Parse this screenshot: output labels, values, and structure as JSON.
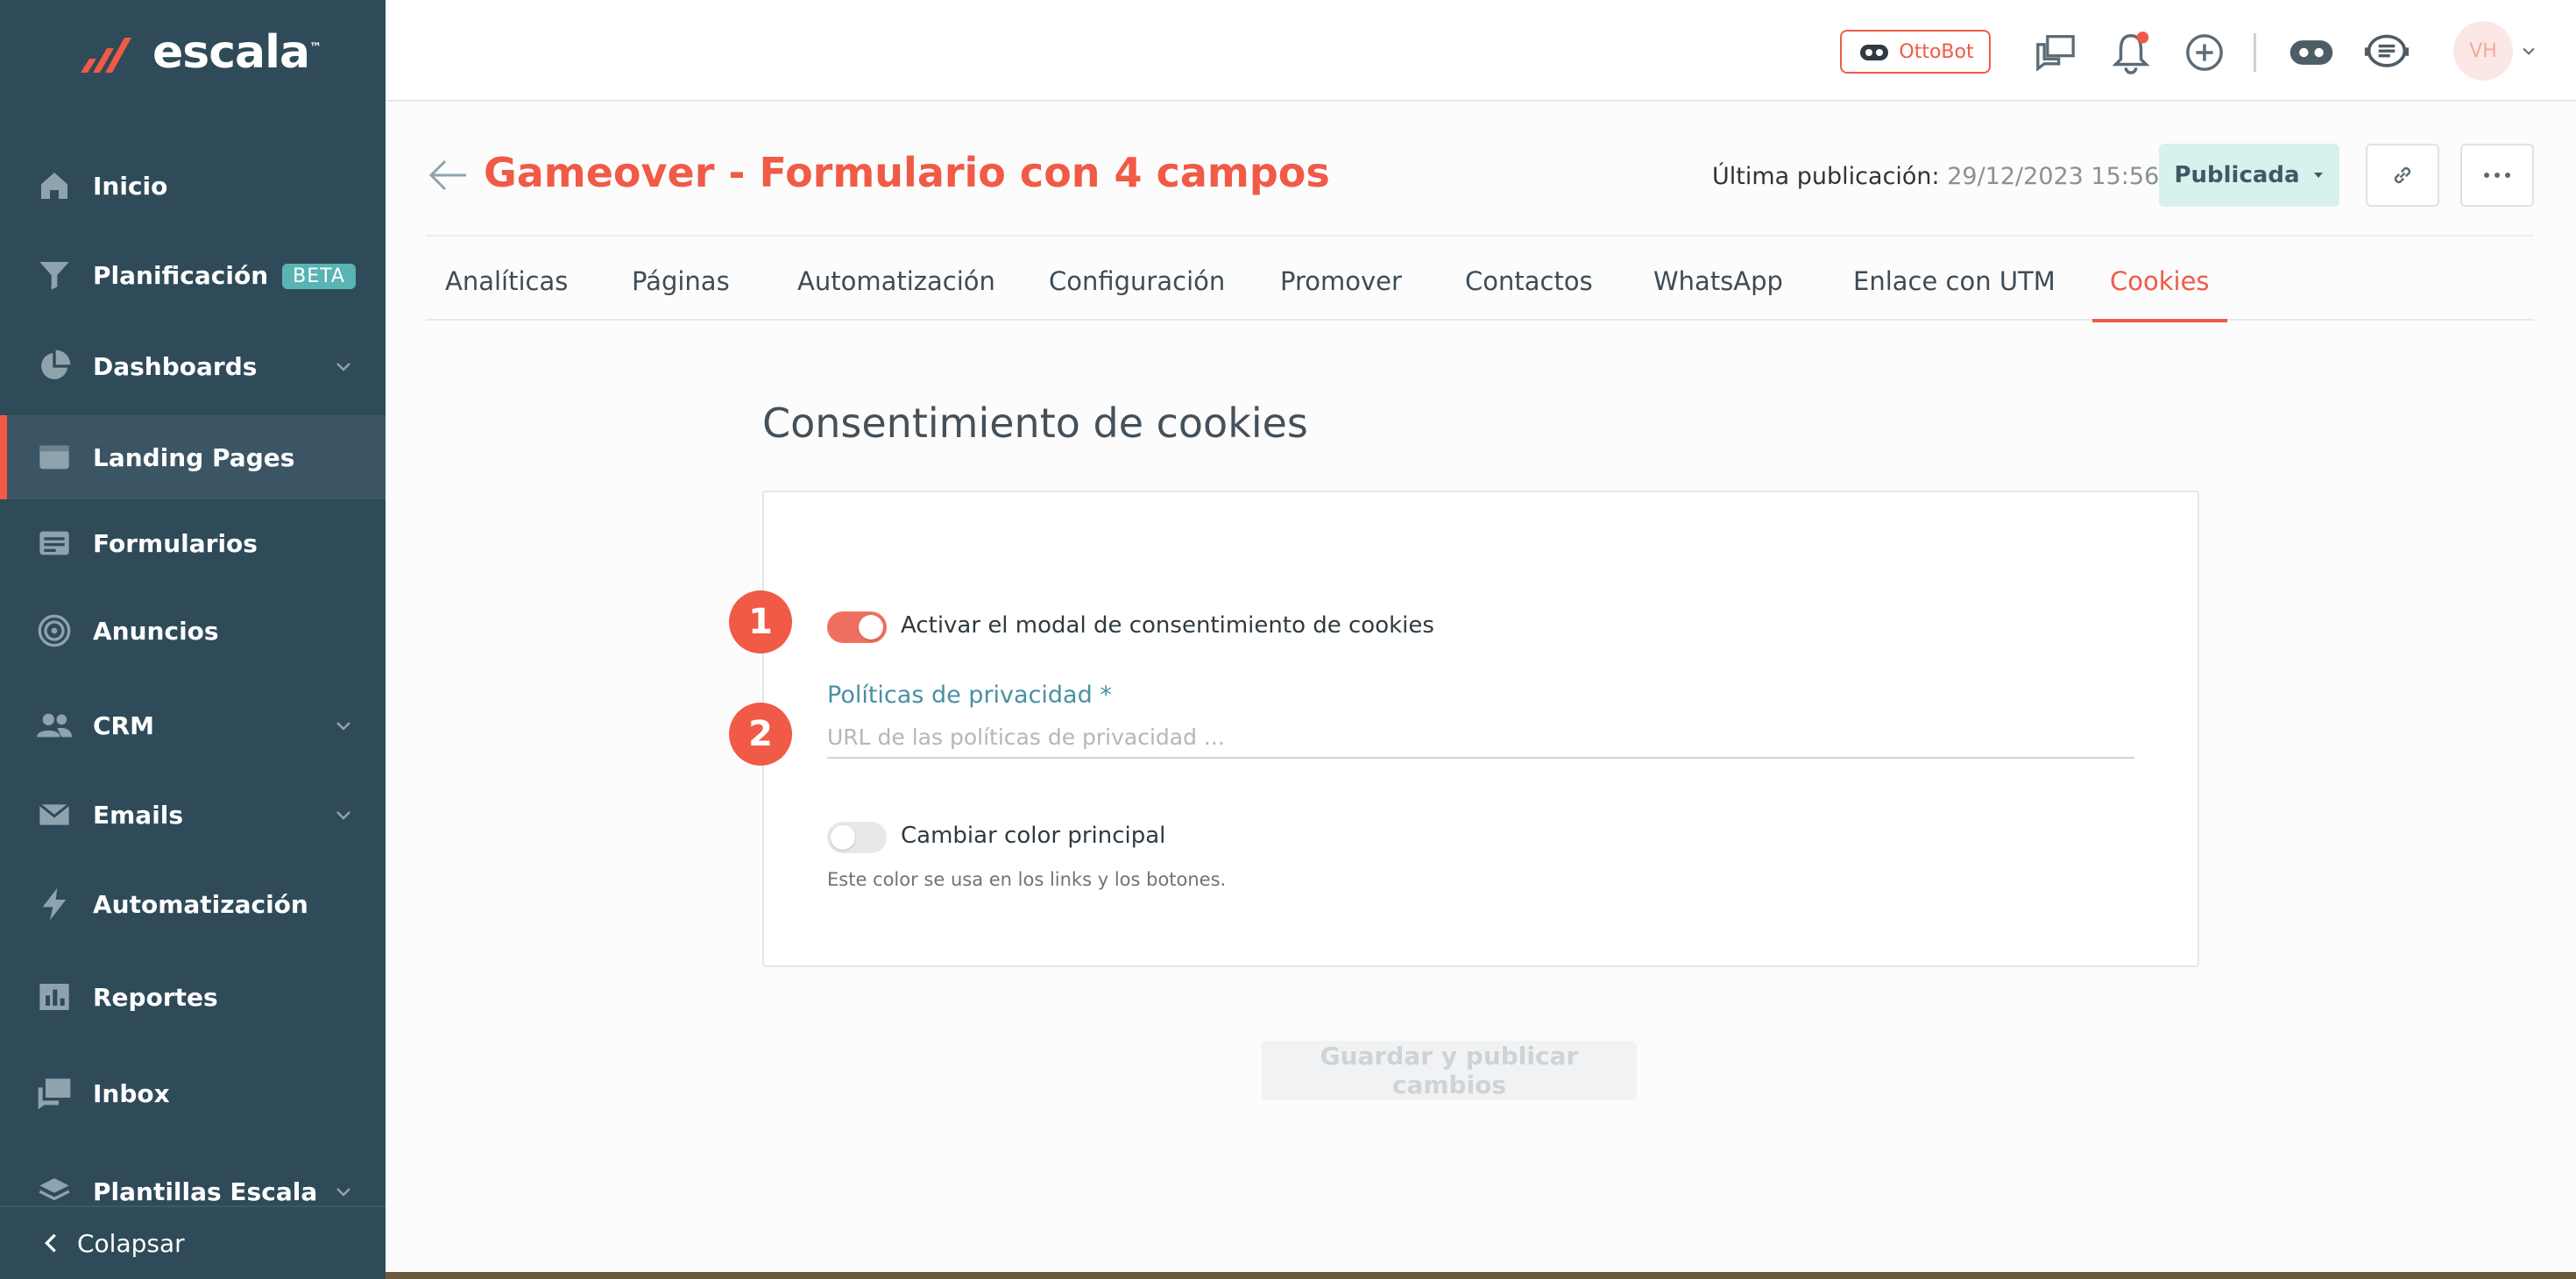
{
  "brand": {
    "name": "escala",
    "tm": "™",
    "accent": "#f05a46",
    "sidebar_bg": "#2f4a59"
  },
  "sidebar": {
    "items": [
      {
        "label": "Inicio",
        "icon": "home-icon"
      },
      {
        "label": "Planificación",
        "icon": "funnel-icon",
        "badge": "BETA"
      },
      {
        "label": "Dashboards",
        "icon": "pie-chart-icon"
      },
      {
        "label": "Landing Pages",
        "icon": "browser-window-icon",
        "active": true
      },
      {
        "label": "Formularios",
        "icon": "form-icon"
      },
      {
        "label": "Anuncios",
        "icon": "target-icon"
      },
      {
        "label": "CRM",
        "icon": "people-icon"
      },
      {
        "label": "Emails",
        "icon": "envelope-icon"
      },
      {
        "label": "Automatización",
        "icon": "lightning-icon"
      },
      {
        "label": "Reportes",
        "icon": "bar-chart-icon"
      },
      {
        "label": "Inbox",
        "icon": "chat-bubbles-icon"
      },
      {
        "label": "Plantillas Escala",
        "icon": "layers-icon"
      }
    ],
    "collapse_label": "Colapsar"
  },
  "topbar": {
    "ottobot_label": "OttoBot",
    "avatar_initials": "VH"
  },
  "header": {
    "title": "Gameover - Formulario con 4 campos",
    "last_pub_label": "Última publicación:",
    "last_pub_value": "29/12/2023 15:56",
    "status_label": "Publicada"
  },
  "tabs": [
    {
      "label": "Analíticas"
    },
    {
      "label": "Páginas"
    },
    {
      "label": "Automatización"
    },
    {
      "label": "Configuración"
    },
    {
      "label": "Promover"
    },
    {
      "label": "Contactos"
    },
    {
      "label": "WhatsApp"
    },
    {
      "label": "Enlace con UTM"
    },
    {
      "label": "Cookies",
      "active": true
    }
  ],
  "content": {
    "section_title": "Consentimiento de cookies",
    "step1": "1",
    "step2": "2",
    "toggle_consent_label": "Activar el modal de consentimiento de cookies",
    "toggle_consent_on": true,
    "privacy_label": "Políticas de privacidad *",
    "privacy_placeholder": "URL de las políticas de privacidad ...",
    "privacy_value": "",
    "toggle_color_label": "Cambiar color principal",
    "toggle_color_on": false,
    "color_hint": "Este color se usa en los links y los botones.",
    "save_label": "Guardar y publicar cambios"
  }
}
